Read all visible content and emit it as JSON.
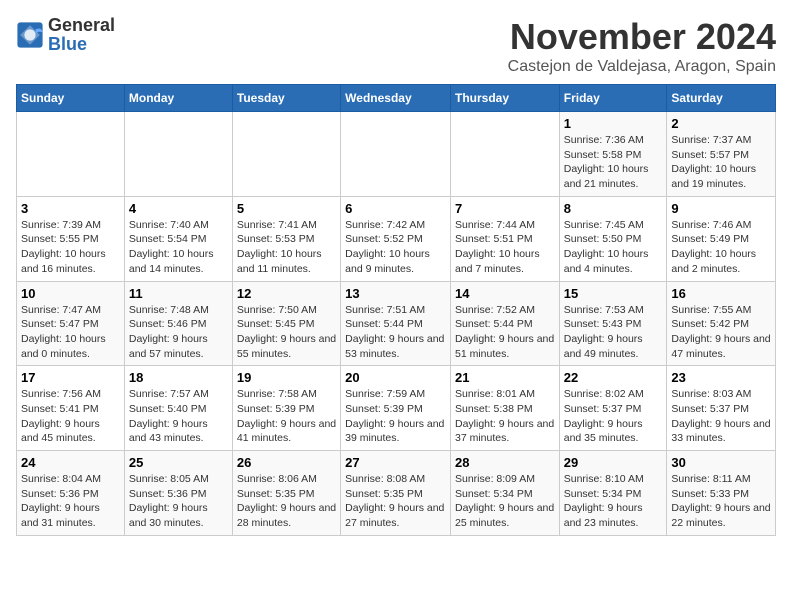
{
  "logo": {
    "general": "General",
    "blue": "Blue"
  },
  "header": {
    "month": "November 2024",
    "location": "Castejon de Valdejasa, Aragon, Spain"
  },
  "weekdays": [
    "Sunday",
    "Monday",
    "Tuesday",
    "Wednesday",
    "Thursday",
    "Friday",
    "Saturday"
  ],
  "weeks": [
    [
      {
        "day": "",
        "info": ""
      },
      {
        "day": "",
        "info": ""
      },
      {
        "day": "",
        "info": ""
      },
      {
        "day": "",
        "info": ""
      },
      {
        "day": "",
        "info": ""
      },
      {
        "day": "1",
        "info": "Sunrise: 7:36 AM\nSunset: 5:58 PM\nDaylight: 10 hours and 21 minutes."
      },
      {
        "day": "2",
        "info": "Sunrise: 7:37 AM\nSunset: 5:57 PM\nDaylight: 10 hours and 19 minutes."
      }
    ],
    [
      {
        "day": "3",
        "info": "Sunrise: 7:39 AM\nSunset: 5:55 PM\nDaylight: 10 hours and 16 minutes."
      },
      {
        "day": "4",
        "info": "Sunrise: 7:40 AM\nSunset: 5:54 PM\nDaylight: 10 hours and 14 minutes."
      },
      {
        "day": "5",
        "info": "Sunrise: 7:41 AM\nSunset: 5:53 PM\nDaylight: 10 hours and 11 minutes."
      },
      {
        "day": "6",
        "info": "Sunrise: 7:42 AM\nSunset: 5:52 PM\nDaylight: 10 hours and 9 minutes."
      },
      {
        "day": "7",
        "info": "Sunrise: 7:44 AM\nSunset: 5:51 PM\nDaylight: 10 hours and 7 minutes."
      },
      {
        "day": "8",
        "info": "Sunrise: 7:45 AM\nSunset: 5:50 PM\nDaylight: 10 hours and 4 minutes."
      },
      {
        "day": "9",
        "info": "Sunrise: 7:46 AM\nSunset: 5:49 PM\nDaylight: 10 hours and 2 minutes."
      }
    ],
    [
      {
        "day": "10",
        "info": "Sunrise: 7:47 AM\nSunset: 5:47 PM\nDaylight: 10 hours and 0 minutes."
      },
      {
        "day": "11",
        "info": "Sunrise: 7:48 AM\nSunset: 5:46 PM\nDaylight: 9 hours and 57 minutes."
      },
      {
        "day": "12",
        "info": "Sunrise: 7:50 AM\nSunset: 5:45 PM\nDaylight: 9 hours and 55 minutes."
      },
      {
        "day": "13",
        "info": "Sunrise: 7:51 AM\nSunset: 5:44 PM\nDaylight: 9 hours and 53 minutes."
      },
      {
        "day": "14",
        "info": "Sunrise: 7:52 AM\nSunset: 5:44 PM\nDaylight: 9 hours and 51 minutes."
      },
      {
        "day": "15",
        "info": "Sunrise: 7:53 AM\nSunset: 5:43 PM\nDaylight: 9 hours and 49 minutes."
      },
      {
        "day": "16",
        "info": "Sunrise: 7:55 AM\nSunset: 5:42 PM\nDaylight: 9 hours and 47 minutes."
      }
    ],
    [
      {
        "day": "17",
        "info": "Sunrise: 7:56 AM\nSunset: 5:41 PM\nDaylight: 9 hours and 45 minutes."
      },
      {
        "day": "18",
        "info": "Sunrise: 7:57 AM\nSunset: 5:40 PM\nDaylight: 9 hours and 43 minutes."
      },
      {
        "day": "19",
        "info": "Sunrise: 7:58 AM\nSunset: 5:39 PM\nDaylight: 9 hours and 41 minutes."
      },
      {
        "day": "20",
        "info": "Sunrise: 7:59 AM\nSunset: 5:39 PM\nDaylight: 9 hours and 39 minutes."
      },
      {
        "day": "21",
        "info": "Sunrise: 8:01 AM\nSunset: 5:38 PM\nDaylight: 9 hours and 37 minutes."
      },
      {
        "day": "22",
        "info": "Sunrise: 8:02 AM\nSunset: 5:37 PM\nDaylight: 9 hours and 35 minutes."
      },
      {
        "day": "23",
        "info": "Sunrise: 8:03 AM\nSunset: 5:37 PM\nDaylight: 9 hours and 33 minutes."
      }
    ],
    [
      {
        "day": "24",
        "info": "Sunrise: 8:04 AM\nSunset: 5:36 PM\nDaylight: 9 hours and 31 minutes."
      },
      {
        "day": "25",
        "info": "Sunrise: 8:05 AM\nSunset: 5:36 PM\nDaylight: 9 hours and 30 minutes."
      },
      {
        "day": "26",
        "info": "Sunrise: 8:06 AM\nSunset: 5:35 PM\nDaylight: 9 hours and 28 minutes."
      },
      {
        "day": "27",
        "info": "Sunrise: 8:08 AM\nSunset: 5:35 PM\nDaylight: 9 hours and 27 minutes."
      },
      {
        "day": "28",
        "info": "Sunrise: 8:09 AM\nSunset: 5:34 PM\nDaylight: 9 hours and 25 minutes."
      },
      {
        "day": "29",
        "info": "Sunrise: 8:10 AM\nSunset: 5:34 PM\nDaylight: 9 hours and 23 minutes."
      },
      {
        "day": "30",
        "info": "Sunrise: 8:11 AM\nSunset: 5:33 PM\nDaylight: 9 hours and 22 minutes."
      }
    ]
  ]
}
